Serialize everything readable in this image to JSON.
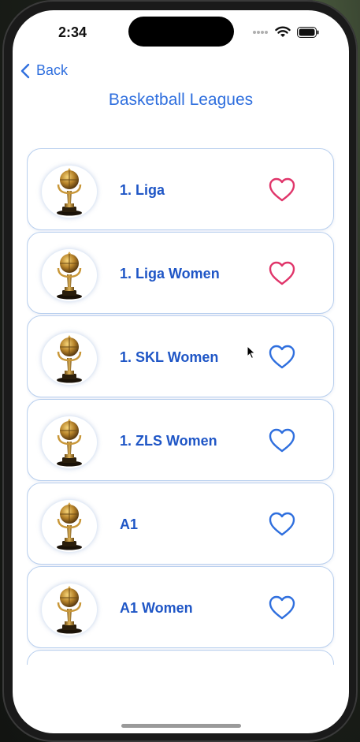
{
  "status_bar": {
    "time": "2:34",
    "signal_icon": "signal-dots-icon",
    "wifi_icon": "wifi-icon",
    "battery_icon": "battery-icon"
  },
  "nav": {
    "back_label": "Back",
    "back_icon": "chevron-left-icon",
    "title": "Basketball Leagues"
  },
  "colors": {
    "accent": "#2f6fde",
    "label": "#1f56c6",
    "favorite": "#e0356a",
    "card_border": "#b8cfee"
  },
  "leagues": [
    {
      "name": "1. Liga",
      "icon": "trophy-icon",
      "favorite": true
    },
    {
      "name": "1. Liga Women",
      "icon": "trophy-icon",
      "favorite": true
    },
    {
      "name": "1. SKL Women",
      "icon": "trophy-icon",
      "favorite": false
    },
    {
      "name": "1. ZLS Women",
      "icon": "trophy-icon",
      "favorite": false
    },
    {
      "name": "A1",
      "icon": "trophy-icon",
      "favorite": false
    },
    {
      "name": "A1 Women",
      "icon": "trophy-icon",
      "favorite": false
    }
  ]
}
